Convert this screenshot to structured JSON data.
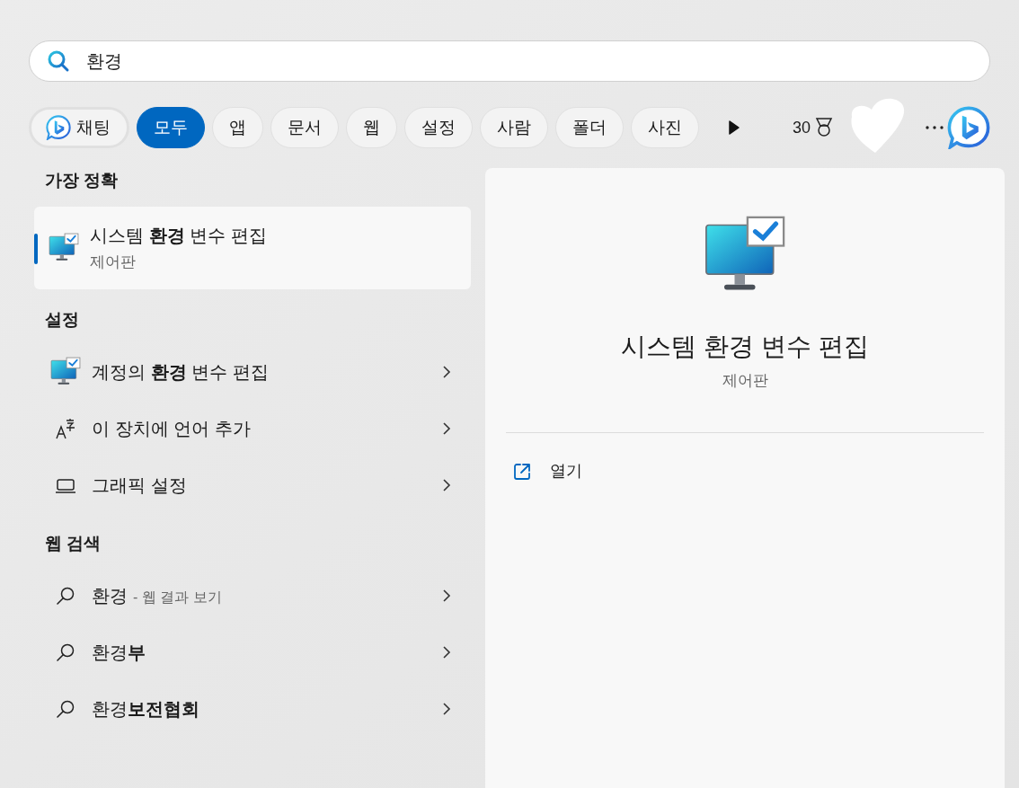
{
  "search": {
    "value": "환경"
  },
  "filters": [
    {
      "label": "채팅",
      "kind": "chat",
      "selected": false
    },
    {
      "label": "모두",
      "kind": "tab",
      "selected": true
    },
    {
      "label": "앱",
      "kind": "tab",
      "selected": false
    },
    {
      "label": "문서",
      "kind": "tab",
      "selected": false
    },
    {
      "label": "웹",
      "kind": "tab",
      "selected": false
    },
    {
      "label": "설정",
      "kind": "tab",
      "selected": false
    },
    {
      "label": "사람",
      "kind": "tab",
      "selected": false
    },
    {
      "label": "폴더",
      "kind": "tab",
      "selected": false
    },
    {
      "label": "사진",
      "kind": "tab",
      "selected": false
    }
  ],
  "points": "30",
  "sections": [
    {
      "title": "가장 정확",
      "items": [
        {
          "kind": "best",
          "title": "시스템 **환경** 변수 편집",
          "subtitle": "제어판",
          "selected": true
        }
      ]
    },
    {
      "title": "설정",
      "items": [
        {
          "kind": "app",
          "title": "계정의 **환경** 변수 편집",
          "selected": false
        },
        {
          "kind": "language",
          "title": "이 장치에 언어 추가",
          "selected": false
        },
        {
          "kind": "display",
          "title": "그래픽 설정",
          "selected": false
        }
      ]
    },
    {
      "title": "웹 검색",
      "items": [
        {
          "kind": "web",
          "title": "환경",
          "hint": "- 웹 결과 보기",
          "selected": false
        },
        {
          "kind": "web",
          "title": "환경**부**",
          "selected": false
        },
        {
          "kind": "web",
          "title": "환경**보전협회**",
          "selected": false
        }
      ]
    }
  ],
  "detail": {
    "title": "시스템 환경 변수 편집",
    "subtitle": "제어판",
    "actions": [
      {
        "label": "열기"
      }
    ]
  }
}
